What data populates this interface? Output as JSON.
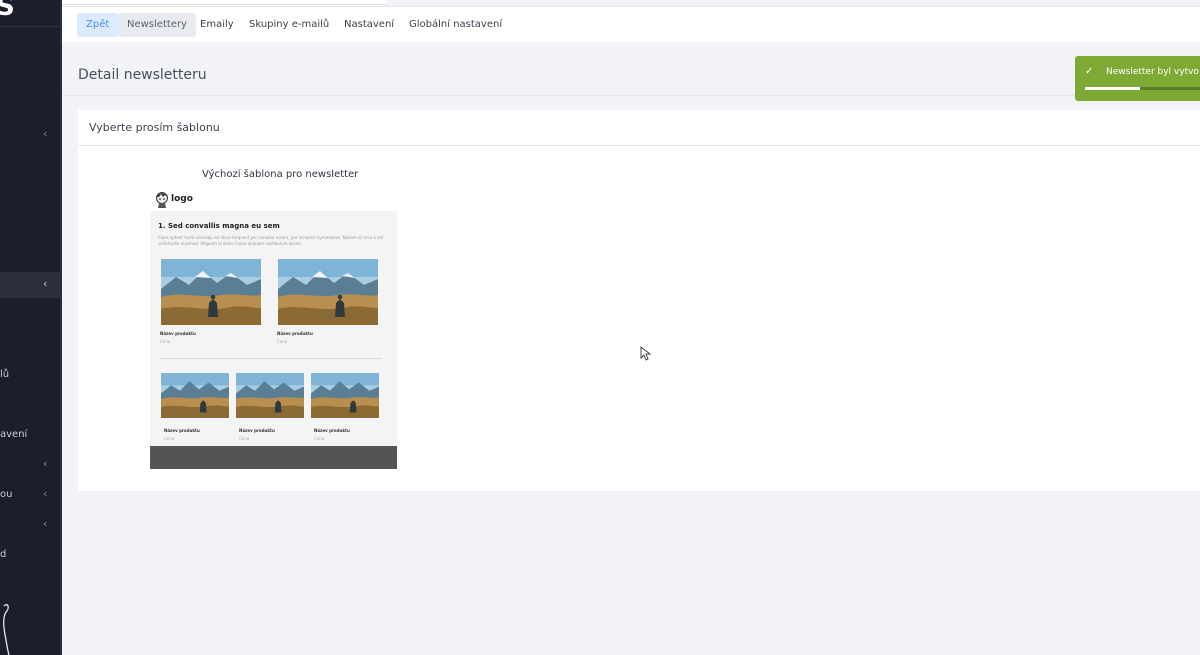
{
  "sidebar": {
    "brand": "S",
    "fragments": [
      "lů",
      "avení",
      "ou",
      "d"
    ]
  },
  "tabs": {
    "back": "Zpět",
    "newsletters": "Newslettery",
    "emails": "Emaily",
    "groups": "Skupiny e-mailů",
    "settings": "Nastavení",
    "global_settings": "Globální nastavení"
  },
  "page": {
    "title": "Detail newsletteru"
  },
  "toast": {
    "message": "Newsletter byl vytvo",
    "progress": 0.42
  },
  "card": {
    "title": "Vyberte prosím šablonu",
    "template_name": "Výchozí šablona pro newsletter"
  },
  "preview": {
    "logo": "logo",
    "heading": "1. Sed convallis magna eu sem",
    "text": "Class aptent taciti sociosqu ad litora torquent per conubia nostra, per inceptos hymenaeos. Nullam at arcu a est sollicitudin euismod. Aliquam id dolor. Fusce aliquam vestibulum ipsum.",
    "product_name": "Název produktu",
    "product_price": "Cena"
  },
  "colors": {
    "sidebar": "#1c1f2b",
    "accent_blue": "#4a8de8",
    "toast": "#7fa935"
  }
}
